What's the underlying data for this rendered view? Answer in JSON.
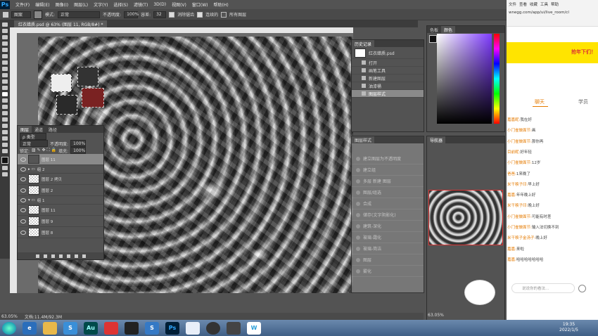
{
  "ps": {
    "menu": [
      "文件(F)",
      "编辑(E)",
      "图像(I)",
      "图层(L)",
      "文字(Y)",
      "选择(S)",
      "滤镜(T)",
      "3D(D)",
      "视图(V)",
      "窗口(W)",
      "帮助(H)"
    ],
    "options": {
      "sample_label": "图案",
      "mode_label": "模式:",
      "mode_value": "正常",
      "opacity_label": "不透明度:",
      "opacity_value": "100%",
      "tolerance_label": "容差:",
      "tolerance_value": "32",
      "antialias": "消除锯齿",
      "contiguous": "连续的",
      "all_layers": "所有图层"
    },
    "doc_tab": "红衣蜡质.psd @ 63% (图层 11, RGB/8#) *",
    "status_zoom": "63.05%",
    "status_doc": "文档:11.4M/92.3M",
    "nav_zoom": "63.05%"
  },
  "layers": {
    "tabs": [
      "图层",
      "通道",
      "路径"
    ],
    "kind": "ρ 类型",
    "blend": "正常",
    "opacity_label": "不透明度:",
    "opacity_value": "100%",
    "lock_label": "锁定:",
    "fill_label": "填充:",
    "fill_value": "100%",
    "items": [
      {
        "name": "图层 11",
        "type": "layer",
        "selected": true
      },
      {
        "name": "组 2",
        "type": "group"
      },
      {
        "name": "图层 2 拷贝",
        "type": "layer"
      },
      {
        "name": "图层 2",
        "type": "layer"
      },
      {
        "name": "组 1",
        "type": "group"
      },
      {
        "name": "图层 11",
        "type": "layer"
      },
      {
        "name": "图层 9",
        "type": "layer"
      },
      {
        "name": "图层 8",
        "type": "layer"
      }
    ]
  },
  "history": {
    "title": "历史记录",
    "snapshot": "红衣蜡质.psd",
    "items": [
      "打开",
      "画笔工具",
      "新建图层",
      "油漆桶",
      "图层样式"
    ]
  },
  "actions": {
    "title": "图层样式",
    "items": [
      "建立图层为不透明度",
      "建立组",
      "多层 新建 图层",
      "图层/组选",
      "合成",
      "储存(文字阴影化)",
      "建筑-深化",
      "玻璃-霜化",
      "玻璃-简洁",
      "图层",
      "雾化"
    ]
  },
  "color": {
    "tabs": [
      "色板",
      "颜色"
    ]
  },
  "navigator": {
    "title": "导航器"
  },
  "chat": {
    "url": "wnegg.com/app/ui/live_room/cl",
    "tabs": [
      "文件",
      "查看",
      "收藏",
      "工具",
      "帮助"
    ],
    "banner": "抢年下们！",
    "tab_chat": "聊天",
    "tab_students": "学员",
    "messages": [
      {
        "user": "嘉嘉昵:",
        "text": "我在好"
      },
      {
        "user": "小门雀做面节:",
        "text": "画"
      },
      {
        "user": "小门雀做面节:",
        "text": "那你再"
      },
      {
        "user": "目前昵:",
        "text": "好年轻"
      },
      {
        "user": "小门雀做面节:",
        "text": "12岁"
      },
      {
        "user": "爸爸:",
        "text": "1来晚了"
      },
      {
        "user": "米干秧子印:",
        "text": "早上好"
      },
      {
        "user": "嘉嘉:",
        "text": "年年晚上好"
      },
      {
        "user": "米干秧子印:",
        "text": "晚上好"
      },
      {
        "user": "小门雀做面节:",
        "text": "可能有时差"
      },
      {
        "user": "小门雀做面节:",
        "text": "输入法切换不到"
      },
      {
        "user": "米干秧子金汤子:",
        "text": "晚上好"
      },
      {
        "user": "嘉嘉:",
        "text": "来啦"
      },
      {
        "user": "嘉嘉:",
        "text": "哈哈哈哈哈哈哈"
      }
    ],
    "input_placeholder": "说说你的看法..."
  },
  "taskbar": {
    "time": "19:35",
    "date": "2022/1/5"
  }
}
